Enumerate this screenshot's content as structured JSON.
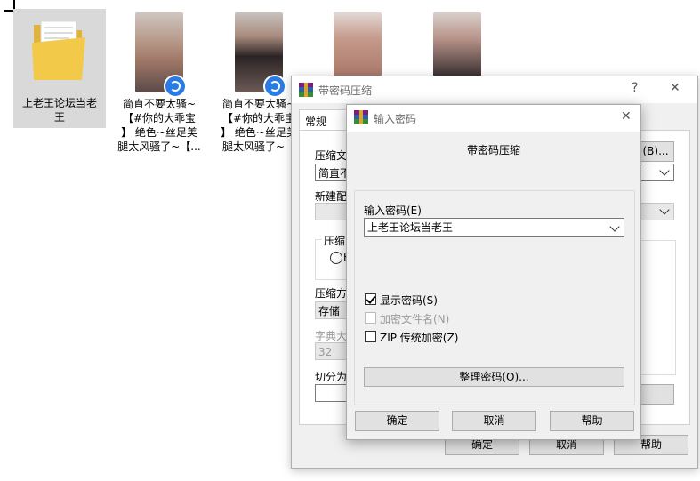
{
  "desktop": {
    "items": [
      {
        "name": "上老王论坛当老王",
        "line1": "上老王论坛当老",
        "line2": "王",
        "kind": "folder"
      },
      {
        "line1": "简直不要太骚~",
        "line2": "【#你的大乖宝",
        "line3": "】 绝色~丝足美",
        "line4": "腿太风骚了~【...",
        "kind": "video"
      },
      {
        "line1": "简直不要太骚~",
        "line2": "【#你的大乖宝",
        "line3": "】 绝色~丝足美",
        "line4": "腿太风骚了~【",
        "kind": "video"
      },
      {
        "kind": "video"
      },
      {
        "kind": "video"
      }
    ]
  },
  "archive_dialog": {
    "title": "带密码压缩",
    "help_glyph": "?",
    "close_glyph": "✕",
    "tab_general": "常规",
    "label_archive_name": "压缩文",
    "archive_name_value": "简直不",
    "browse_button": "(B)...",
    "label_profile": "新建配",
    "label_format": "压缩",
    "radio_partial": "R",
    "label_method": "压缩方",
    "method_value": "存储",
    "label_dict": "字典大",
    "dict_value": "32",
    "label_split": "切分为",
    "ok_button": "确定",
    "cancel_button": "取消",
    "help_button": "帮助"
  },
  "password_dialog": {
    "title": "输入密码",
    "heading": "带密码压缩",
    "password_label": "输入密码(E)",
    "password_value": "上老王论坛当老王",
    "show_password_label": "显示密码(S)",
    "show_password_checked": true,
    "encrypt_names_label": "加密文件名(N)",
    "encrypt_names_checked": false,
    "encrypt_names_enabled": false,
    "zip_legacy_label": "ZIP 传统加密(Z)",
    "zip_legacy_checked": false,
    "organize_button": "整理密码(O)...",
    "ok_button": "确定",
    "cancel_button": "取消",
    "help_button": "帮助",
    "close_glyph": "✕"
  },
  "colors": {
    "folder_yellow": "#f3c94a",
    "selection_gray": "#d9d9d9",
    "dialog_bg": "#f0f0f0",
    "button_bg": "#e1e1e1",
    "accent_blue": "#0078d7",
    "badge_blue": "#2a7be4"
  }
}
